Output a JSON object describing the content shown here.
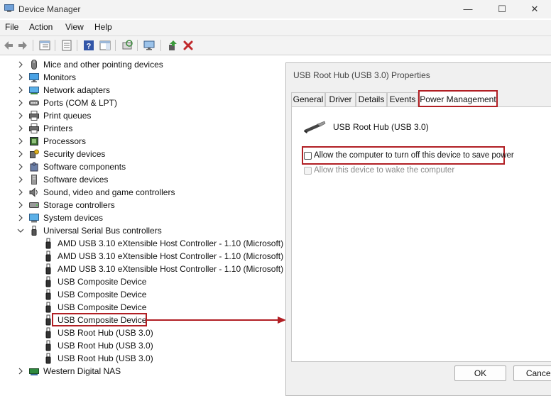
{
  "window": {
    "title": "Device Manager",
    "minimize": "—",
    "maximize": "☐",
    "close": "✕"
  },
  "menu": [
    "File",
    "Action",
    "View",
    "Help"
  ],
  "toolbar_icons": [
    "back-arrow-icon",
    "forward-arrow-icon",
    "tree-view-icon",
    "properties-sheet-icon",
    "help-icon",
    "action-pane-icon",
    "scan-hardware-icon",
    "monitor-icon",
    "update-driver-icon",
    "uninstall-x-icon"
  ],
  "tree": {
    "categories": [
      {
        "label": "Mice and other pointing devices",
        "icon": "mouse-icon",
        "expanded": false
      },
      {
        "label": "Monitors",
        "icon": "monitor-icon",
        "expanded": false
      },
      {
        "label": "Network adapters",
        "icon": "network-adapter-icon",
        "expanded": false
      },
      {
        "label": "Ports (COM & LPT)",
        "icon": "port-icon",
        "expanded": false
      },
      {
        "label": "Print queues",
        "icon": "printer-icon",
        "expanded": false
      },
      {
        "label": "Printers",
        "icon": "printer-icon",
        "expanded": false
      },
      {
        "label": "Processors",
        "icon": "processor-icon",
        "expanded": false
      },
      {
        "label": "Security devices",
        "icon": "security-key-icon",
        "expanded": false
      },
      {
        "label": "Software components",
        "icon": "puzzle-icon",
        "expanded": false
      },
      {
        "label": "Software devices",
        "icon": "software-device-icon",
        "expanded": false
      },
      {
        "label": "Sound, video and game controllers",
        "icon": "speaker-icon",
        "expanded": false
      },
      {
        "label": "Storage controllers",
        "icon": "storage-icon",
        "expanded": false
      },
      {
        "label": "System devices",
        "icon": "system-device-icon",
        "expanded": false
      },
      {
        "label": "Universal Serial Bus controllers",
        "icon": "usb-icon",
        "expanded": true
      }
    ],
    "usb_children": [
      "AMD USB 3.10 eXtensible Host Controller - 1.10 (Microsoft)",
      "AMD USB 3.10 eXtensible Host Controller - 1.10 (Microsoft)",
      "AMD USB 3.10 eXtensible Host Controller - 1.10 (Microsoft)",
      "USB Composite Device",
      "USB Composite Device",
      "USB Composite Device",
      "USB Composite Device",
      "USB Root Hub (USB 3.0)",
      "USB Root Hub (USB 3.0)",
      "USB Root Hub (USB 3.0)"
    ],
    "last_category": {
      "label": "Western Digital NAS",
      "icon": "nas-icon",
      "expanded": false
    }
  },
  "dialog": {
    "title": "USB Root Hub (USB 3.0) Properties",
    "tabs": [
      "General",
      "Driver",
      "Details",
      "Events",
      "Power Management"
    ],
    "active_tab": "Power Management",
    "device_name": "USB Root Hub (USB 3.0)",
    "option_turn_off": "Allow the computer to turn off this device to save power",
    "option_wake": "Allow this device to wake the computer",
    "ok": "OK",
    "cancel": "Cancel"
  },
  "colors": {
    "highlight": "#b11f24",
    "accent": "#2b6cc4"
  }
}
